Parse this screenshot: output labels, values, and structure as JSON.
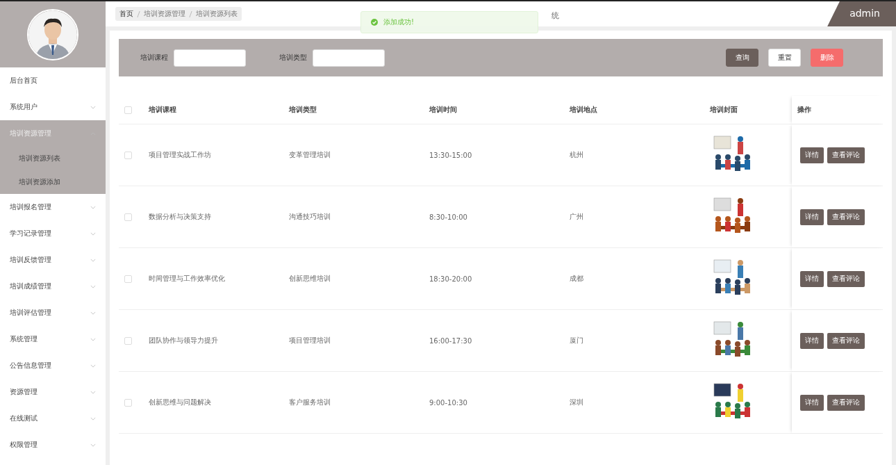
{
  "sidebar": {
    "items": [
      {
        "label": "后台首页",
        "expanded": false,
        "has_children": false
      },
      {
        "label": "系统用户",
        "expanded": false,
        "has_children": true
      },
      {
        "label": "培训资源管理",
        "expanded": true,
        "has_children": true,
        "children": [
          {
            "label": "培训资源列表"
          },
          {
            "label": "培训资源添加"
          }
        ]
      },
      {
        "label": "培训报名管理",
        "expanded": false,
        "has_children": true
      },
      {
        "label": "学习记录管理",
        "expanded": false,
        "has_children": true
      },
      {
        "label": "培训反馈管理",
        "expanded": false,
        "has_children": true
      },
      {
        "label": "培训成绩管理",
        "expanded": false,
        "has_children": true
      },
      {
        "label": "培训评估管理",
        "expanded": false,
        "has_children": true
      },
      {
        "label": "系统管理",
        "expanded": false,
        "has_children": true
      },
      {
        "label": "公告信息管理",
        "expanded": false,
        "has_children": true
      },
      {
        "label": "资源管理",
        "expanded": false,
        "has_children": true
      },
      {
        "label": "在线测试",
        "expanded": false,
        "has_children": true
      },
      {
        "label": "权限管理",
        "expanded": false,
        "has_children": true
      }
    ]
  },
  "breadcrumb": [
    "首页",
    "培训资源管理",
    "培训资源列表"
  ],
  "header": {
    "title": "统",
    "user": "admin"
  },
  "toast": {
    "message": "添加成功!"
  },
  "search": {
    "fields": [
      {
        "label": "培训课程"
      },
      {
        "label": "培训类型"
      }
    ],
    "buttons": [
      {
        "label": "查询",
        "kind": "primary"
      },
      {
        "label": "重置",
        "kind": "plain"
      },
      {
        "label": "删除",
        "kind": "danger"
      }
    ]
  },
  "table": {
    "select_all_checked": false,
    "columns": [
      "培训课程",
      "培训类型",
      "培训时间",
      "培训地点",
      "培训封面",
      "操作"
    ],
    "rows": [
      {
        "checked": false,
        "cells": [
          "项目管理实战工作坊",
          "变革管理培训",
          "13:30-15:00",
          "杭州"
        ],
        "actions": [
          "详情",
          "查看评论"
        ]
      },
      {
        "checked": false,
        "cells": [
          "数据分析与决策支持",
          "沟通技巧培训",
          "8:30-10:00",
          "广州"
        ],
        "actions": [
          "详情",
          "查看评论"
        ]
      },
      {
        "checked": false,
        "cells": [
          "时间管理与工作效率优化",
          "创新思维培训",
          "18:30-20:00",
          "成都"
        ],
        "actions": [
          "详情",
          "查看评论"
        ]
      },
      {
        "checked": false,
        "cells": [
          "团队协作与领导力提升",
          "项目管理培训",
          "16:00-17:30",
          "厦门"
        ],
        "actions": [
          "详情",
          "查看评论"
        ]
      },
      {
        "checked": false,
        "cells": [
          "创新思维与问题解决",
          "客户服务培训",
          "9:00-10:30",
          "深圳"
        ],
        "actions": [
          "详情",
          "查看评论"
        ]
      }
    ]
  }
}
